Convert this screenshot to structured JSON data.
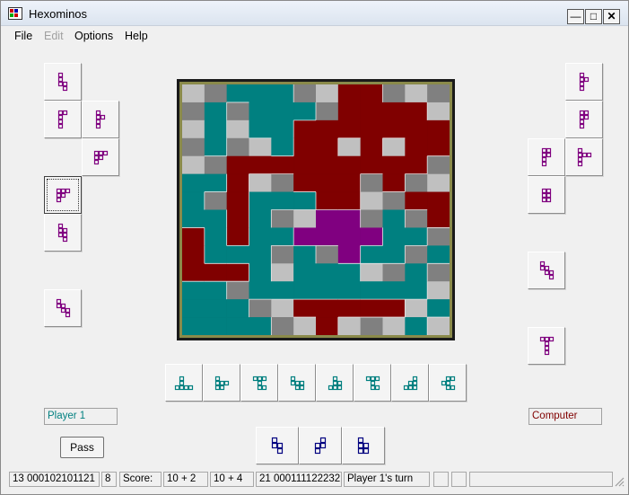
{
  "window": {
    "title": "Hexominos"
  },
  "menu": [
    "File",
    "Edit",
    "Options",
    "Help"
  ],
  "menu_disabled": [
    false,
    true,
    false,
    false
  ],
  "colors": {
    "player1": "#008080",
    "computer": "#800000",
    "center": "#800080",
    "empty_light": "#c0c0c0",
    "empty_dark": "#808080",
    "player1_piece_icon": "#800080",
    "bottom_piece_icon": "#008080",
    "tray_piece_icon": "#000080"
  },
  "board": {
    "rows": [
      "..PPP..CC...",
      ".P.PPP.CCCC.",
      ".P.PPCCCCCCC",
      ".P..PCC.C.CC",
      "..CCCCCCCCC.",
      "PPC..CCC.C..",
      "P.CPPPCC..CC",
      "PPCP..MM.P.C",
      "CPCPPMMMMPP.",
      "CPPP.P.MPP.P",
      "CCCP.PPP..P.",
      "PP.PPPPPPPP.",
      "PPP..CCCCC.P",
      "PPPP..C...P."
    ]
  },
  "left_tray": [
    {
      "cells": [
        [
          0,
          0
        ],
        [
          0,
          1
        ],
        [
          0,
          2
        ],
        [
          1,
          2
        ],
        [
          1,
          3
        ]
      ]
    },
    {
      "cells": [
        [
          0,
          0
        ],
        [
          1,
          0
        ],
        [
          0,
          1
        ],
        [
          0,
          2
        ],
        [
          0,
          3
        ]
      ]
    },
    {
      "cells": [
        [
          0,
          0
        ],
        [
          1,
          1
        ],
        [
          0,
          1
        ],
        [
          0,
          2
        ],
        [
          0,
          3
        ]
      ]
    },
    {
      "cells": [
        [
          0,
          0
        ],
        [
          1,
          0
        ],
        [
          2,
          0
        ],
        [
          0,
          1
        ],
        [
          1,
          1
        ],
        [
          0,
          2
        ]
      ]
    },
    {
      "cells": [
        [
          0,
          0
        ],
        [
          1,
          0
        ],
        [
          2,
          0
        ],
        [
          0,
          1
        ],
        [
          0,
          2
        ],
        [
          1,
          1
        ]
      ]
    },
    {
      "cells": [
        [
          0,
          0
        ],
        [
          0,
          1
        ],
        [
          1,
          1
        ],
        [
          0,
          2
        ],
        [
          1,
          2
        ],
        [
          1,
          3
        ]
      ]
    },
    {
      "cells": [
        [
          0,
          0
        ],
        [
          0,
          1
        ],
        [
          1,
          1
        ],
        [
          1,
          2
        ],
        [
          2,
          2
        ],
        [
          2,
          3
        ]
      ]
    }
  ],
  "right_tray": [
    {
      "cells": [
        [
          0,
          0
        ],
        [
          0,
          1
        ],
        [
          1,
          1
        ],
        [
          0,
          2
        ],
        [
          0,
          3
        ]
      ]
    },
    {
      "cells": [
        [
          0,
          0
        ],
        [
          0,
          1
        ],
        [
          1,
          1
        ],
        [
          0,
          2
        ],
        [
          0,
          3
        ],
        [
          1,
          0
        ]
      ]
    },
    {
      "cells": [
        [
          0,
          0
        ],
        [
          1,
          0
        ],
        [
          0,
          1
        ],
        [
          1,
          1
        ],
        [
          0,
          2
        ],
        [
          0,
          3
        ]
      ]
    },
    {
      "cells": [
        [
          0,
          0
        ],
        [
          0,
          1
        ],
        [
          1,
          1
        ],
        [
          2,
          1
        ],
        [
          0,
          2
        ],
        [
          0,
          3
        ]
      ]
    },
    {
      "cells": [
        [
          0,
          0
        ],
        [
          1,
          0
        ],
        [
          0,
          1
        ],
        [
          1,
          1
        ],
        [
          0,
          2
        ],
        [
          1,
          2
        ]
      ]
    },
    {
      "cells": [
        [
          0,
          0
        ],
        [
          0,
          1
        ],
        [
          1,
          1
        ],
        [
          1,
          2
        ],
        [
          2,
          2
        ],
        [
          2,
          3
        ]
      ]
    },
    {
      "cells": [
        [
          0,
          0
        ],
        [
          1,
          0
        ],
        [
          2,
          0
        ],
        [
          1,
          1
        ],
        [
          1,
          2
        ],
        [
          1,
          3
        ]
      ]
    }
  ],
  "bottom_pieces": [
    {
      "cells": [
        [
          1,
          0
        ],
        [
          1,
          1
        ],
        [
          0,
          2
        ],
        [
          1,
          2
        ],
        [
          2,
          2
        ],
        [
          3,
          2
        ]
      ]
    },
    {
      "cells": [
        [
          0,
          0
        ],
        [
          0,
          1
        ],
        [
          1,
          1
        ],
        [
          2,
          1
        ],
        [
          0,
          2
        ],
        [
          1,
          2
        ]
      ]
    },
    {
      "cells": [
        [
          0,
          0
        ],
        [
          1,
          0
        ],
        [
          2,
          0
        ],
        [
          1,
          1
        ],
        [
          1,
          2
        ],
        [
          2,
          2
        ]
      ]
    },
    {
      "cells": [
        [
          0,
          0
        ],
        [
          0,
          1
        ],
        [
          1,
          1
        ],
        [
          2,
          1
        ],
        [
          1,
          2
        ],
        [
          2,
          2
        ]
      ]
    },
    {
      "cells": [
        [
          1,
          0
        ],
        [
          1,
          1
        ],
        [
          0,
          2
        ],
        [
          1,
          2
        ],
        [
          2,
          2
        ],
        [
          2,
          1
        ]
      ]
    },
    {
      "cells": [
        [
          0,
          0
        ],
        [
          1,
          0
        ],
        [
          2,
          0
        ],
        [
          1,
          1
        ],
        [
          1,
          2
        ],
        [
          2,
          2
        ]
      ]
    },
    {
      "cells": [
        [
          2,
          0
        ],
        [
          1,
          1
        ],
        [
          2,
          1
        ],
        [
          0,
          2
        ],
        [
          1,
          2
        ],
        [
          2,
          2
        ]
      ]
    },
    {
      "cells": [
        [
          1,
          0
        ],
        [
          2,
          0
        ],
        [
          0,
          1
        ],
        [
          1,
          1
        ],
        [
          1,
          2
        ],
        [
          2,
          2
        ]
      ]
    }
  ],
  "tray_pieces": [
    {
      "cells": [
        [
          0,
          0
        ],
        [
          0,
          1
        ],
        [
          1,
          1
        ],
        [
          1,
          2
        ]
      ]
    },
    {
      "cells": [
        [
          1,
          0
        ],
        [
          0,
          1
        ],
        [
          1,
          1
        ],
        [
          0,
          2
        ]
      ]
    },
    {
      "cells": [
        [
          0,
          0
        ],
        [
          0,
          1
        ],
        [
          1,
          1
        ],
        [
          0,
          2
        ],
        [
          1,
          2
        ]
      ]
    }
  ],
  "players": {
    "player1": "Player 1",
    "computer": "Computer"
  },
  "pass_label": "Pass",
  "status": {
    "seq1": "13 000102101121",
    "count": "8",
    "score_label": "Score:",
    "score1": "10 + 2",
    "score2": "10 + 4",
    "seq2": "21 000111122232",
    "turn": "Player 1's turn"
  }
}
